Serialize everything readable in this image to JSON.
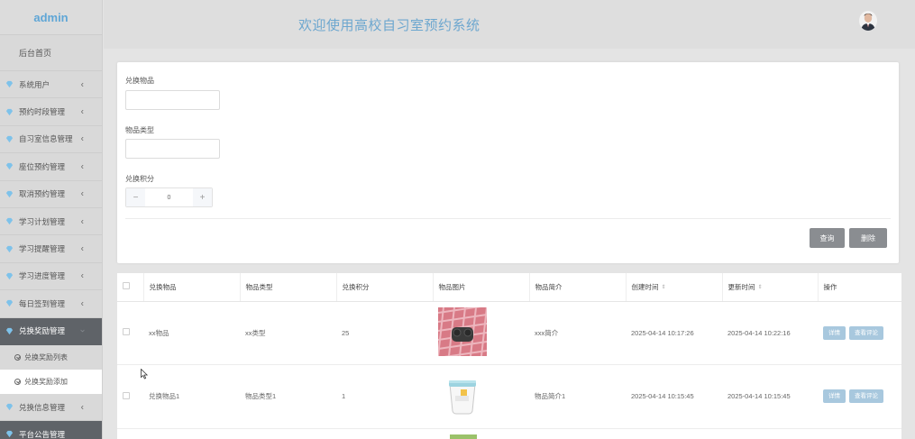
{
  "sidebar": {
    "brand": "admin",
    "home": "后台首页",
    "items": [
      {
        "label": "系统用户"
      },
      {
        "label": "预约时段管理"
      },
      {
        "label": "自习室信息管理"
      },
      {
        "label": "座位预约管理"
      },
      {
        "label": "取消预约管理"
      },
      {
        "label": "学习计划管理"
      },
      {
        "label": "学习提醒管理"
      },
      {
        "label": "学习进度管理"
      },
      {
        "label": "每日签到管理"
      },
      {
        "label": "兑换奖励管理"
      }
    ],
    "sub_items": [
      {
        "label": "兑换奖励列表"
      },
      {
        "label": "兑换奖励添加"
      }
    ],
    "after_items": [
      {
        "label": "兑换信息管理"
      },
      {
        "label": "平台公告管理"
      }
    ]
  },
  "header": {
    "title": "欢迎使用高校自习室预约系统"
  },
  "search": {
    "field1_label": "兑换物品",
    "field1_value": "",
    "field2_label": "物品类型",
    "field2_value": "",
    "field3_label": "兑换积分",
    "stepper_value": "0",
    "query_button": "查询",
    "delete_button": "删除"
  },
  "table": {
    "headers": [
      "兑换物品",
      "物品类型",
      "兑换积分",
      "物品图片",
      "物品简介",
      "创建时间",
      "更新时间",
      "操作"
    ],
    "rows": [
      {
        "name": "xx物品",
        "type": "xx类型",
        "points": "25",
        "intro": "xxx简介",
        "created": "2025-04-14 10:17:26",
        "updated": "2025-04-14 10:22:16",
        "btn1": "详情",
        "btn2": "查看评论"
      },
      {
        "name": "兑换物品1",
        "type": "物品类型1",
        "points": "1",
        "intro": "物品简介1",
        "created": "2025-04-14 10:15:45",
        "updated": "2025-04-14 10:15:45",
        "btn1": "详情",
        "btn2": "查看评论"
      }
    ]
  },
  "icons": {
    "menu": "diamond-icon",
    "expand": "chevron-left-icon",
    "sub": "check-circle-icon",
    "sort": "sort-caret-icon"
  },
  "colors": {
    "brand": "#5fa6d6",
    "header_title": "#6da7cf",
    "active_menu": "#5f6368",
    "action_button": "#a8c8de",
    "search_button": "#8a8d91"
  }
}
